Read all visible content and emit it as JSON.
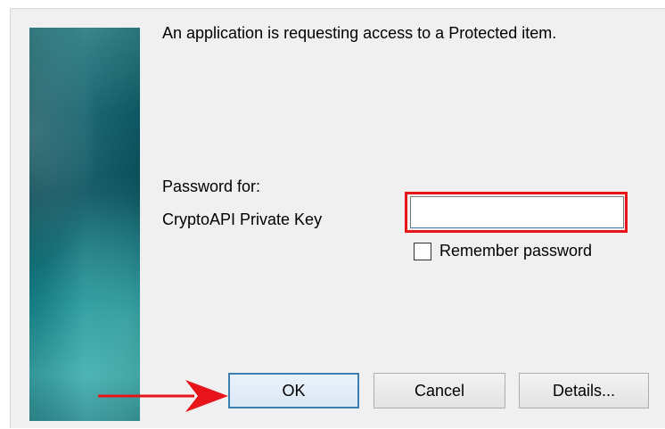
{
  "dialog": {
    "message": "An application is requesting access to a Protected item.",
    "password_for_label": "Password for:",
    "item_name": "CryptoAPI Private Key",
    "password_input": {
      "value": "",
      "placeholder": ""
    },
    "remember_checkbox": {
      "label": "Remember password",
      "checked": false
    },
    "buttons": {
      "ok": "OK",
      "cancel": "Cancel",
      "details": "Details..."
    }
  },
  "annotations": {
    "highlight_color": "#e8141b",
    "arrow_color": "#e8141b",
    "arrow_target": "ok-button",
    "highlight_target": "password-input"
  },
  "icons": {
    "arrow": "arrow-right-icon"
  }
}
